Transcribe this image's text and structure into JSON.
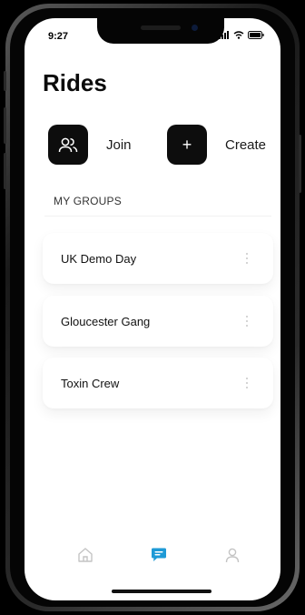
{
  "status_bar": {
    "time": "9:27",
    "icons": [
      "signal-icon",
      "wifi-icon",
      "battery-icon"
    ]
  },
  "page": {
    "title": "Rides"
  },
  "actions": [
    {
      "label": "Join",
      "icon": "users-icon"
    },
    {
      "label": "Create",
      "icon": "plus-icon",
      "glyph": "+"
    }
  ],
  "groups": {
    "section_label": "MY GROUPS",
    "items": [
      {
        "name": "UK Demo Day"
      },
      {
        "name": "Gloucester Gang"
      },
      {
        "name": "Toxin Crew"
      }
    ]
  },
  "tab_bar": {
    "tabs": [
      {
        "icon": "home-icon",
        "active": false
      },
      {
        "icon": "chat-icon",
        "active": true
      },
      {
        "icon": "profile-icon",
        "active": false
      }
    ],
    "active_color": "#1e9ad6",
    "inactive_color": "#c4c4c4"
  },
  "colors": {
    "primary": "#0d0d0d",
    "background": "#ffffff",
    "accent": "#1e9ad6"
  }
}
